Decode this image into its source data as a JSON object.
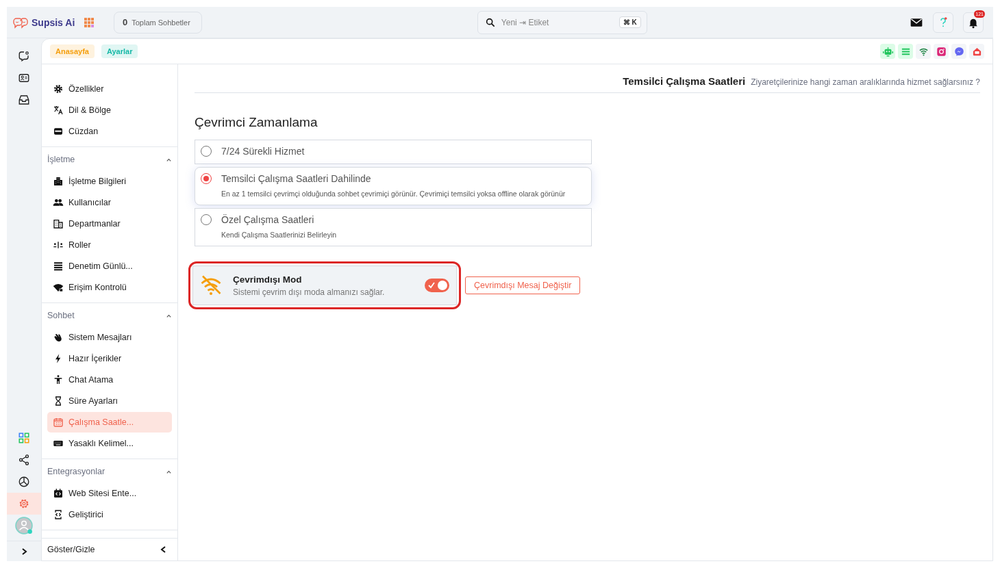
{
  "brand": {
    "name": "Supsis Ai"
  },
  "total_chats": {
    "count": "0",
    "label": "Toplam Sohbetler"
  },
  "search": {
    "placeholder": "Yeni ⇥ Etiket",
    "shortcut": "⌘ K"
  },
  "notifications": {
    "badge": "121"
  },
  "breadcrumbs": [
    {
      "label": "Anasayfa",
      "color": "#f59e0b"
    },
    {
      "label": "Ayarlar",
      "color": "#14b8a6"
    }
  ],
  "rail": [
    {
      "kind": "chat",
      "selected": false
    },
    {
      "kind": "contact",
      "selected": false
    },
    {
      "kind": "inbox",
      "selected": false
    },
    {
      "kind": "apps",
      "selected": false
    },
    {
      "kind": "share",
      "selected": false
    },
    {
      "kind": "chart",
      "selected": false
    },
    {
      "kind": "settings",
      "selected": true
    },
    {
      "kind": "avatar",
      "selected": false
    }
  ],
  "channels": [
    {
      "kind": "robot",
      "color": "#22c55e"
    },
    {
      "kind": "list",
      "color": "#22c55e"
    },
    {
      "kind": "wifi",
      "color": "#15803d"
    },
    {
      "kind": "instagram",
      "color": "#db2777"
    },
    {
      "kind": "messenger",
      "color": "#6366f1"
    },
    {
      "kind": "chatbox",
      "color": "#ef4444"
    }
  ],
  "sidebar": {
    "sections": [
      {
        "items": [
          {
            "kind": "gear",
            "label": "Özellikler",
            "selected": false
          },
          {
            "kind": "translate",
            "label": "Dil & Bölge",
            "selected": false
          },
          {
            "kind": "wallet",
            "label": "Cüzdan",
            "selected": false
          }
        ]
      },
      {
        "title": "İşletme",
        "expanded": true,
        "items": [
          {
            "kind": "building",
            "label": "İşletme Bilgileri",
            "selected": false
          },
          {
            "kind": "people",
            "label": "Kullanıcılar",
            "selected": false
          },
          {
            "kind": "office",
            "label": "Departmanlar",
            "selected": false
          },
          {
            "kind": "roles",
            "label": "Roller",
            "selected": false
          },
          {
            "kind": "list",
            "label": "Denetim Günlü...",
            "selected": false
          },
          {
            "kind": "wifi-lock",
            "label": "Erişim Kontrolü",
            "selected": false
          }
        ]
      },
      {
        "title": "Sohbet",
        "expanded": true,
        "items": [
          {
            "kind": "hand",
            "label": "Sistem Mesajları",
            "selected": false
          },
          {
            "kind": "bolt",
            "label": "Hazır İçerikler",
            "selected": false
          },
          {
            "kind": "person",
            "label": "Chat Atama",
            "selected": false
          },
          {
            "kind": "hourglass",
            "label": "Süre Ayarları",
            "selected": false
          },
          {
            "kind": "calendar",
            "label": "Çalışma Saatle...",
            "selected": true
          },
          {
            "kind": "keyboard",
            "label": "Yasaklı Kelimel...",
            "selected": false
          }
        ]
      },
      {
        "title": "Entegrasyonlar",
        "expanded": true,
        "items": [
          {
            "kind": "code",
            "label": "Web Sitesi Ente...",
            "selected": false
          },
          {
            "kind": "phone-code",
            "label": "Geliştirici",
            "selected": false
          }
        ]
      }
    ],
    "footer": "Göster/Gizle"
  },
  "page_header": {
    "title": "Temsilci Çalışma Saatleri",
    "subtitle": "Ziyaretçilerinize hangi zaman aralıklarında hizmet sağlarsınız ?"
  },
  "scheduling": {
    "heading": "Çevrimci Zamanlama",
    "options": [
      {
        "label": "7/24 Sürekli Hizmet",
        "selected": false
      },
      {
        "label": "Temsilci Çalışma Saatleri Dahilinde",
        "description": "En az 1 temsilci çevrimçi olduğunda sohbet çevrimiçi görünür. Çevrimiçi temsilci yoksa offline olarak görünür",
        "selected": true
      },
      {
        "label": "Özel Çalışma Saatleri",
        "description": "Kendi Çalışma Saatlerinizi Belirleyin",
        "selected": false
      }
    ]
  },
  "offline_mode": {
    "title": "Çevrimdışı Mod",
    "description": "Sistemi çevrim dışı moda almanızı sağlar.",
    "on": true,
    "highlighted": true,
    "button": "Çevrimdışı Mesaj Değiştir"
  }
}
